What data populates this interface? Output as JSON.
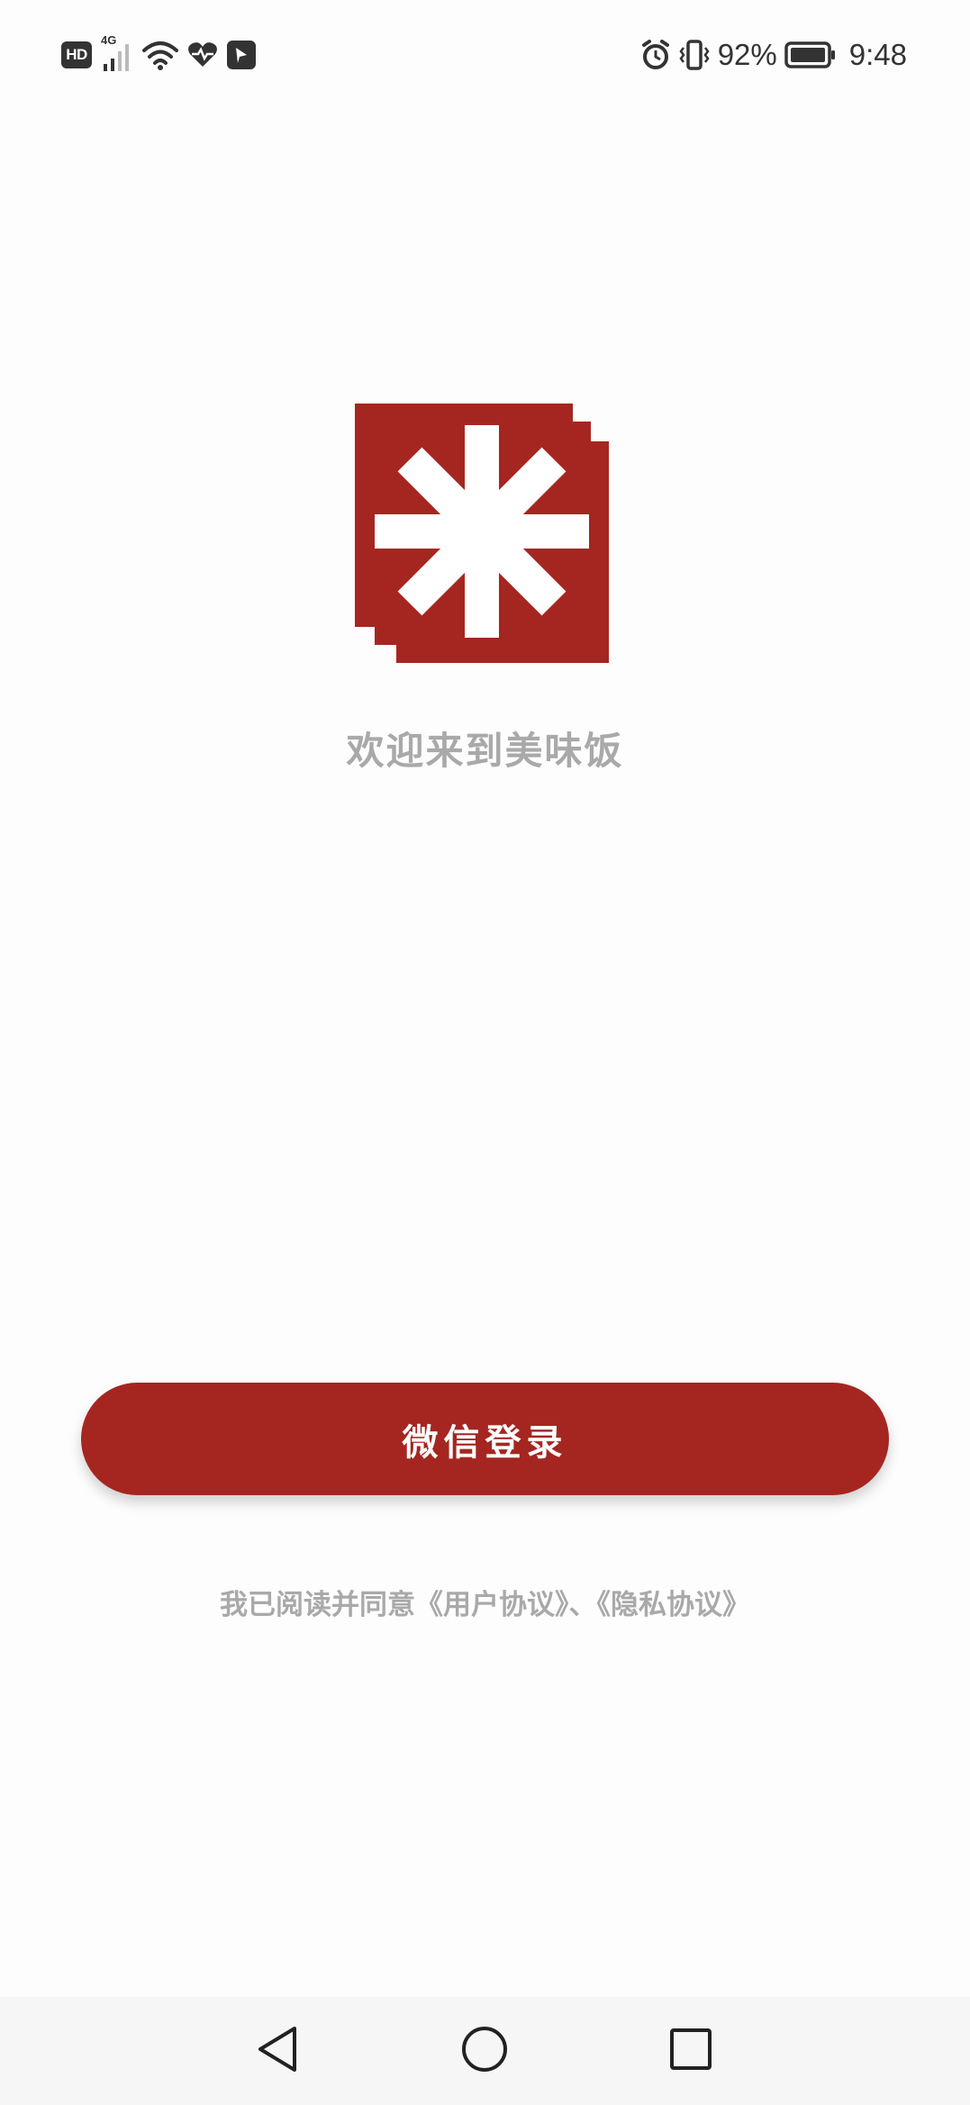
{
  "status_bar": {
    "hd_label": "HD",
    "network_label": "4G",
    "battery_percent": "92%",
    "time": "9:48",
    "icons": [
      "hd-icon",
      "signal-icon",
      "wifi-icon",
      "health-icon",
      "app-notification-icon",
      "alarm-icon",
      "vibrate-icon",
      "battery-icon"
    ]
  },
  "main": {
    "logo": "app-logo-asterisk",
    "welcome_text": "欢迎来到美味饭",
    "login_button_label": "微信登录",
    "agreement": {
      "prefix": "我已阅读并同意",
      "user_agreement": "《用户协议》",
      "separator": "、",
      "privacy_policy": "《隐私协议》"
    }
  },
  "nav_bar": {
    "icons": [
      "back-icon",
      "home-icon",
      "recents-icon"
    ]
  },
  "colors": {
    "brand_red": "#a52620",
    "muted_text": "#a9a9a9",
    "background": "#fdfdfd"
  }
}
